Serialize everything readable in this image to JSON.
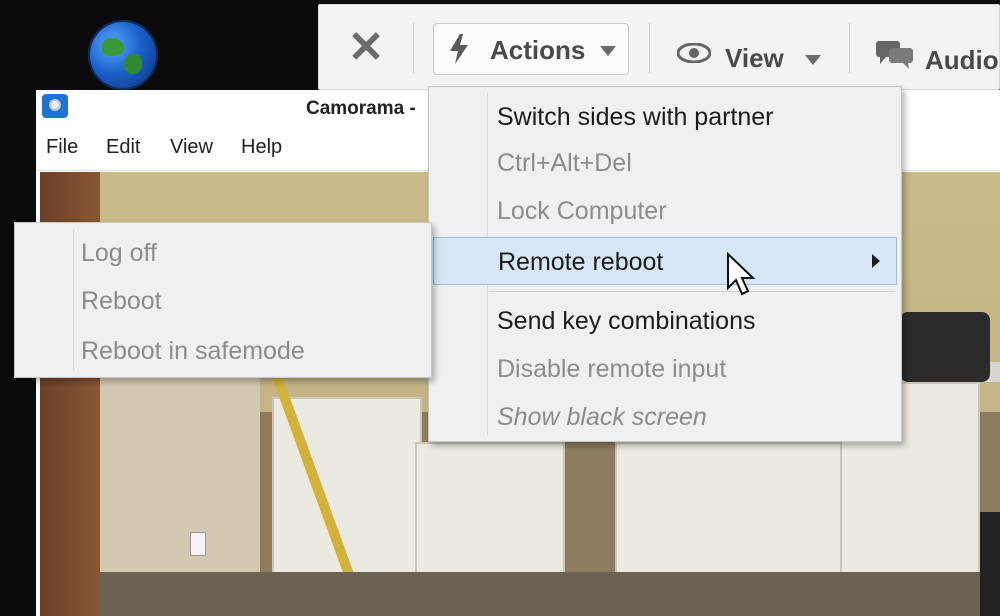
{
  "window": {
    "title": "Camorama -",
    "menu": [
      "File",
      "Edit",
      "View",
      "Help"
    ]
  },
  "toolbar": {
    "close_icon": "close-icon",
    "actions_label": "Actions",
    "view_label": "View",
    "audio_label": "Audio"
  },
  "actions_menu": {
    "items": [
      {
        "label": "Switch sides with partner",
        "disabled": false
      },
      {
        "label": "Ctrl+Alt+Del",
        "disabled": true
      },
      {
        "label": "Lock Computer",
        "disabled": true
      },
      {
        "label": "Remote reboot",
        "disabled": false,
        "highlighted": true,
        "has_submenu": true
      },
      {
        "label": "Send key combinations",
        "disabled": false
      },
      {
        "label": "Disable remote input",
        "disabled": true
      },
      {
        "label": "Show black screen",
        "disabled": true
      }
    ]
  },
  "reboot_submenu": {
    "items": [
      {
        "label": "Log off",
        "disabled": true
      },
      {
        "label": "Reboot",
        "disabled": true
      },
      {
        "label": "Reboot in safemode",
        "disabled": true
      }
    ]
  },
  "colors": {
    "highlight": "#d7e6f6",
    "menu_bg": "#f0f0f0",
    "disabled_text": "#8c8c8c"
  }
}
